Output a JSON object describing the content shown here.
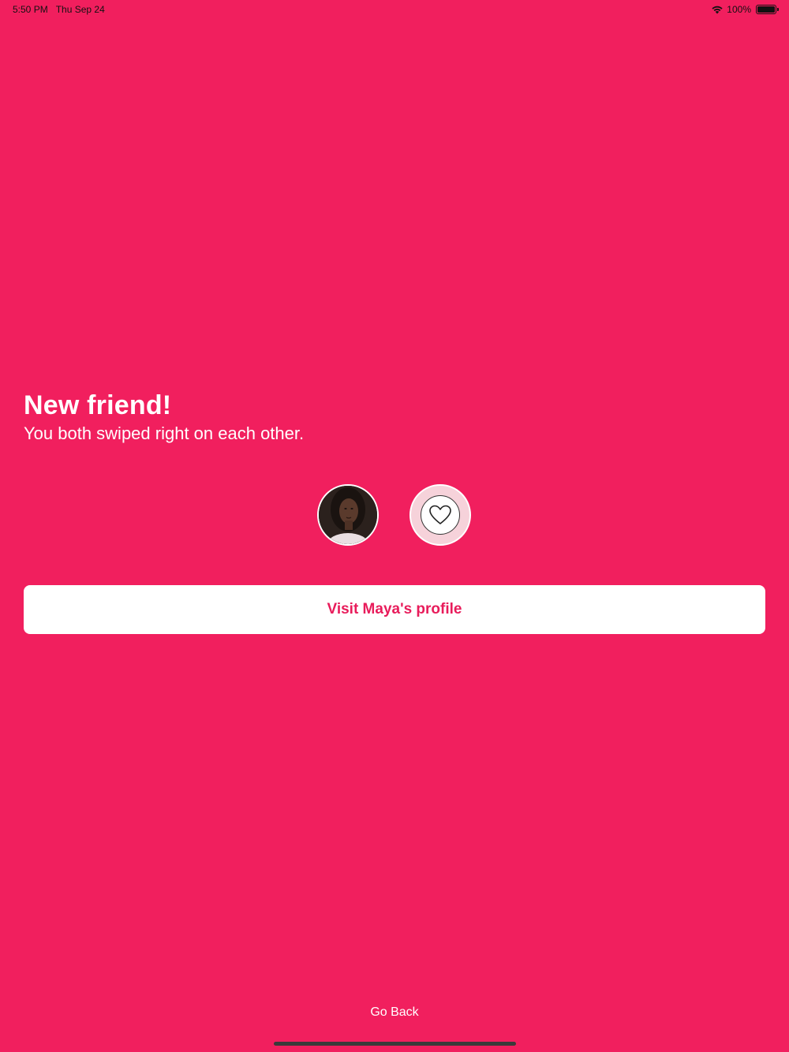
{
  "status_bar": {
    "time": "5:50 PM",
    "date": "Thu Sep 24",
    "battery": "100%",
    "icons": [
      "wifi-icon",
      "battery-icon"
    ]
  },
  "match": {
    "title": "New friend!",
    "subtitle": "You both swiped right on each other."
  },
  "avatars": {
    "photo_icon": "avatar-photo",
    "heart_icon": "heart-icon"
  },
  "actions": {
    "visit_label": "Visit Maya's profile",
    "go_back_label": "Go Back"
  },
  "colors": {
    "background": "#f11f5e",
    "button_text": "#e81c5b",
    "heart_circle": "#f6d2da"
  }
}
